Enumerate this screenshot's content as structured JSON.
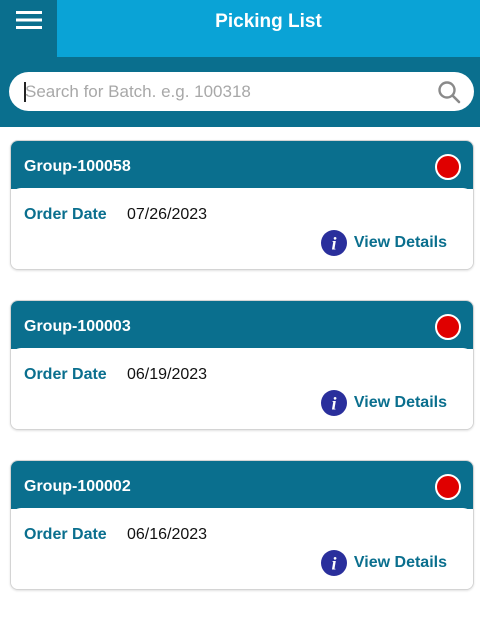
{
  "header": {
    "title": "Picking List",
    "menu_icon": "hamburger-menu-icon"
  },
  "search": {
    "placeholder": "Search for Batch. e.g. 100318",
    "value": "",
    "icon": "search-icon"
  },
  "colors": {
    "header_bg": "#0aa3d6",
    "dark_teal": "#0a6f8e",
    "status_red": "#e00000",
    "info_icon": "#2a2f9c"
  },
  "groups": [
    {
      "name": "Group-100058",
      "order_label": "Order Date",
      "order_date": "07/26/2023",
      "details_label": "View Details",
      "status": "red"
    },
    {
      "name": "Group-100003",
      "order_label": "Order Date",
      "order_date": "06/19/2023",
      "details_label": "View Details",
      "status": "red"
    },
    {
      "name": "Group-100002",
      "order_label": "Order Date",
      "order_date": "06/16/2023",
      "details_label": "View Details",
      "status": "red"
    }
  ]
}
